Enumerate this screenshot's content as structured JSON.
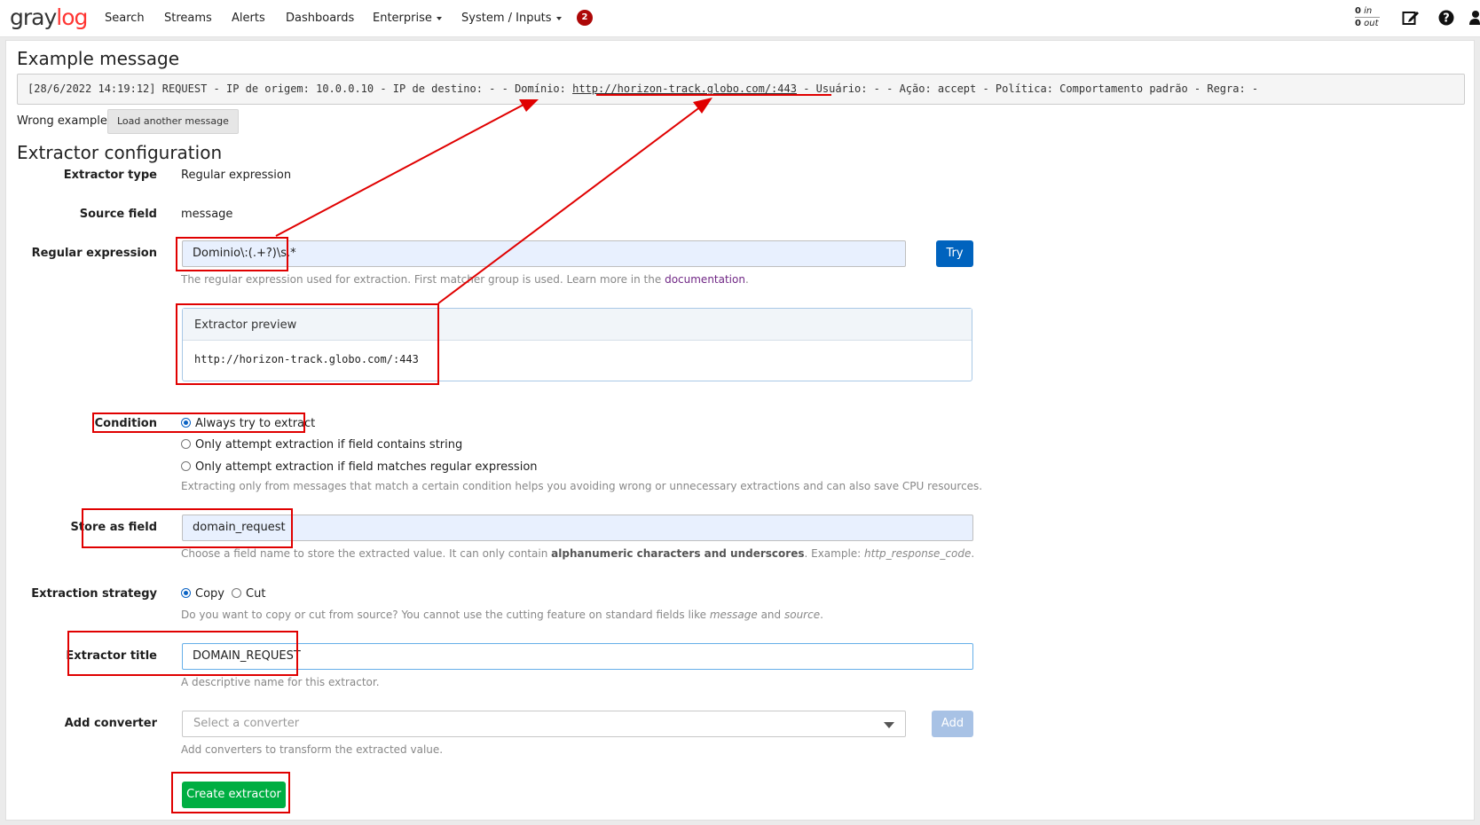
{
  "nav": {
    "logo_part1": "gray",
    "logo_part2": "log",
    "items": [
      "Search",
      "Streams",
      "Alerts",
      "Dashboards",
      "Enterprise",
      "System / Inputs"
    ],
    "notification_count": "2",
    "throughput_in_value": "0",
    "throughput_in_label": "in",
    "throughput_out_value": "0",
    "throughput_out_label": "out"
  },
  "example": {
    "title": "Example message",
    "message_prefix": "[28/6/2022 14:19:12] REQUEST - IP de origem: 10.0.0.10 - IP de destino: - - Domínio: ",
    "message_domain": "http://horizon-track.globo.com/:443",
    "message_suffix": " - Usuário: - - Ação: accept - Política: Comportamento padrão - Regra: -",
    "wrong_label": "Wrong example?",
    "load_another": "Load another message"
  },
  "config": {
    "title": "Extractor configuration",
    "extractor_type_label": "Extractor type",
    "extractor_type_value": "Regular expression",
    "source_field_label": "Source field",
    "source_field_value": "message",
    "regex_label": "Regular expression",
    "regex_value": "Dominio\\:(.+?)\\s.*",
    "try_label": "Try",
    "regex_help_prefix": "The regular expression used for extraction. First matcher group is used. Learn more in the ",
    "regex_help_link": "documentation",
    "regex_help_suffix": ".",
    "preview_title": "Extractor preview",
    "preview_value": "http://horizon-track.globo.com/:443",
    "condition_label": "Condition",
    "condition_options": [
      "Always try to extract",
      "Only attempt extraction if field contains string",
      "Only attempt extraction if field matches regular expression"
    ],
    "condition_help": "Extracting only from messages that match a certain condition helps you avoiding wrong or unnecessary extractions and can also save CPU resources.",
    "store_label": "Store as field",
    "store_value": "domain_request",
    "store_help_prefix": "Choose a field name to store the extracted value. It can only contain ",
    "store_help_bold": "alphanumeric characters and underscores",
    "store_help_mid": ". Example: ",
    "store_help_example": "http_response_code",
    "store_help_suffix": ".",
    "strategy_label": "Extraction strategy",
    "strategy_copy": "Copy",
    "strategy_cut": "Cut",
    "strategy_help_prefix": "Do you want to copy or cut from source? You cannot use the cutting feature on standard fields like ",
    "strategy_help_em1": "message",
    "strategy_help_and": " and ",
    "strategy_help_em2": "source",
    "strategy_help_suffix": ".",
    "title_label": "Extractor title",
    "title_value": "DOMAIN_REQUEST",
    "title_help": "A descriptive name for this extractor.",
    "converter_label": "Add converter",
    "converter_placeholder": "Select a converter",
    "add_label": "Add",
    "converter_help": "Add converters to transform the extracted value.",
    "create_label": "Create extractor"
  },
  "colors": {
    "annotation": "#e00000",
    "primary": "#0063be",
    "success": "#00ae42",
    "badge": "#ad0707"
  }
}
